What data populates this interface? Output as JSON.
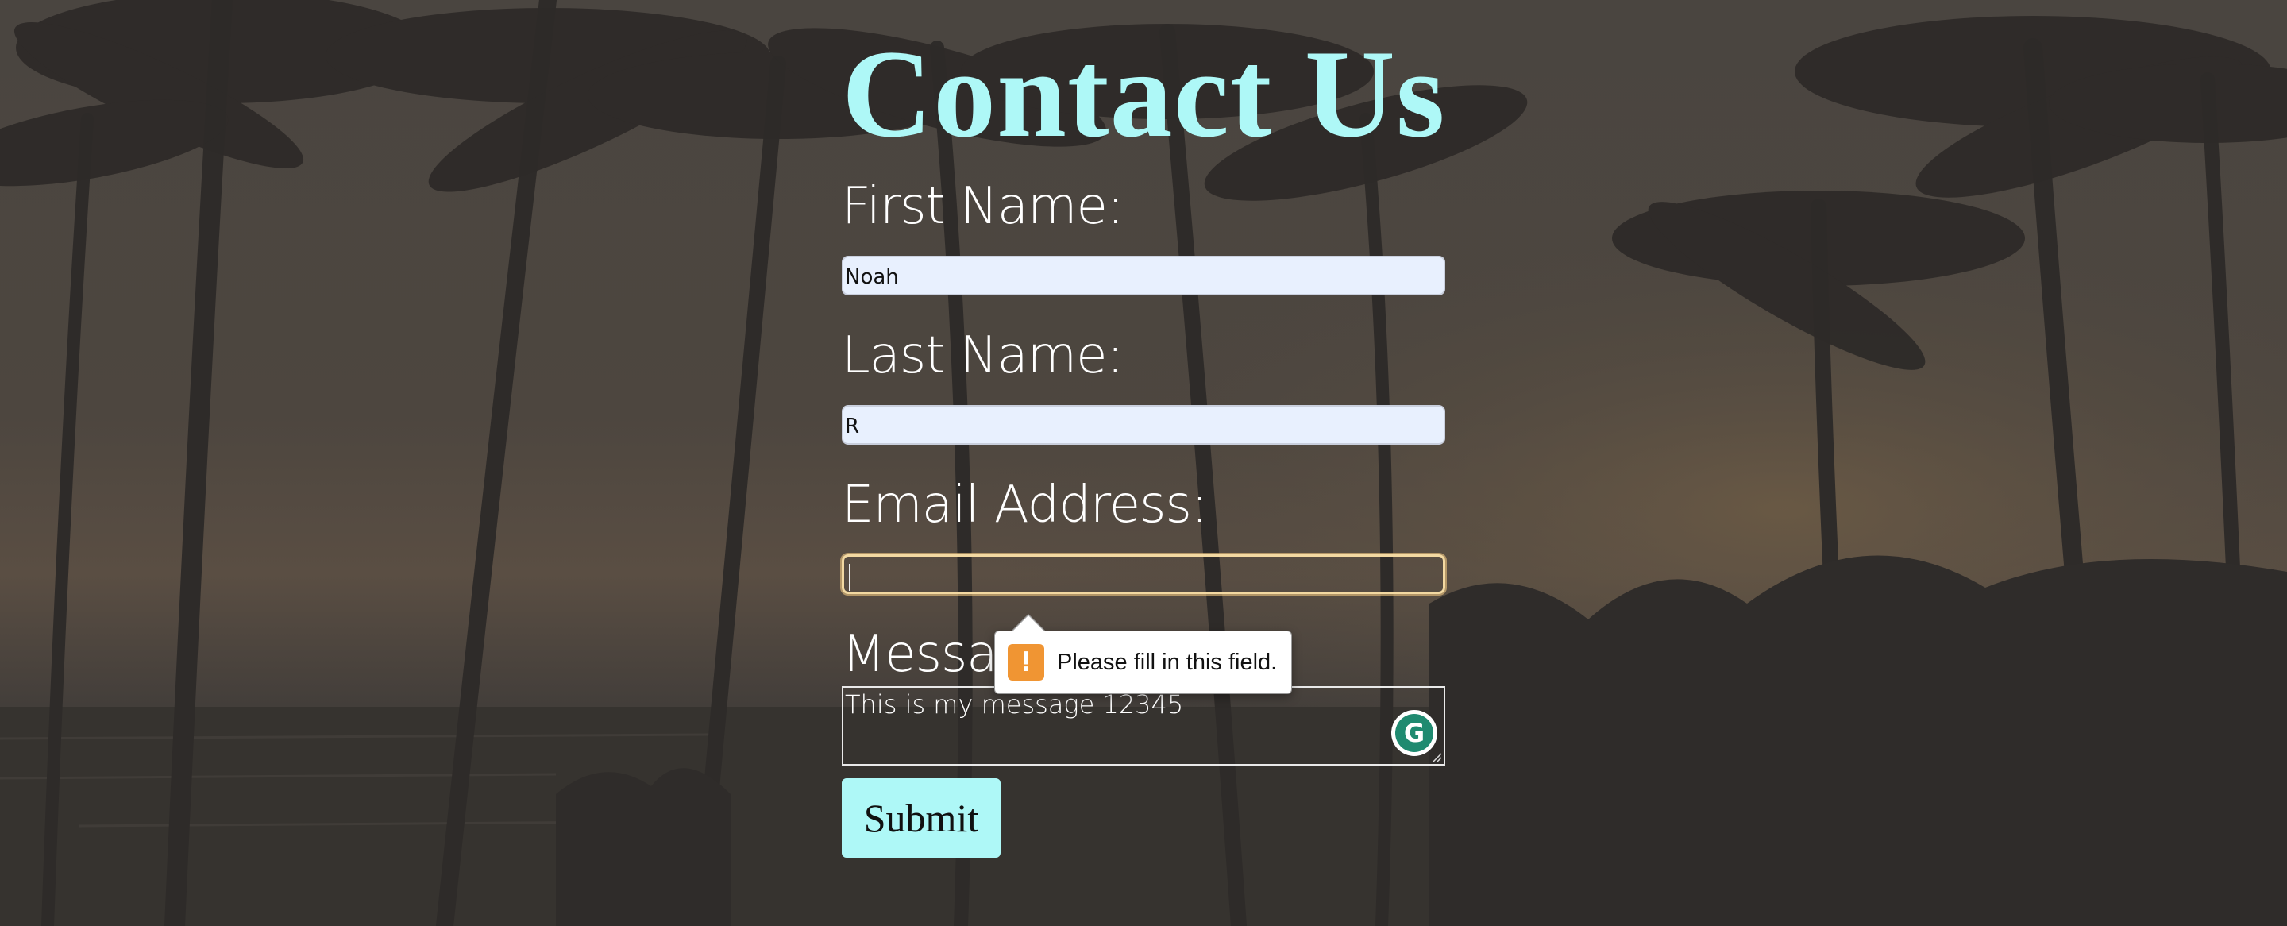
{
  "page": {
    "title": "Contact Us"
  },
  "form": {
    "first_name": {
      "label": "First Name:",
      "value": "Noah"
    },
    "last_name": {
      "label": "Last Name:",
      "value": "R"
    },
    "email": {
      "label": "Email Address:",
      "value": ""
    },
    "message": {
      "label": "Message:",
      "value": "This is my message 12345"
    },
    "submit_label": "Submit"
  },
  "validation": {
    "message": "Please fill in this field.",
    "icon": "warning-icon"
  },
  "extension": {
    "icon": "grammarly-icon",
    "glyph": "G"
  },
  "colors": {
    "accent": "#aef8f7",
    "background_overlay": "#3f3b37",
    "warning": "#f09533",
    "autofill": "#e8f0fe"
  }
}
